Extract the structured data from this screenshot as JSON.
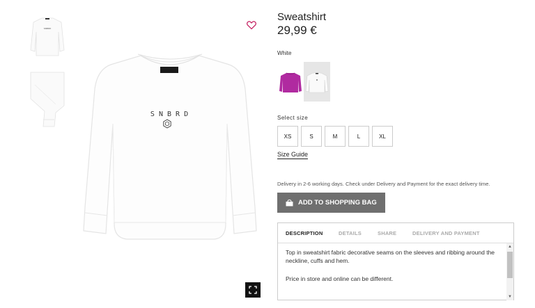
{
  "product": {
    "title": "Sweatshirt",
    "price": "29,99 €",
    "print_text": "S N B R D",
    "colors": {
      "selected_label": "White",
      "options": [
        {
          "name": "purple",
          "hex": "#b02aa0"
        },
        {
          "name": "white",
          "hex": "#f5f5f5"
        }
      ]
    }
  },
  "sizes": {
    "label": "Select size",
    "options": [
      "XS",
      "S",
      "M",
      "L",
      "XL"
    ],
    "guide_label": "Size Guide"
  },
  "delivery_text": "Delivery in 2-6 working days. Check under Delivery and Payment for the exact delivery time.",
  "add_to_bag": {
    "label": "ADD TO SHOPPING BAG",
    "icon": "shopping-bag-icon",
    "color": "#6f6f6f"
  },
  "tabs": [
    {
      "label": "DESCRIPTION",
      "active": true
    },
    {
      "label": "DETAILS",
      "active": false
    },
    {
      "label": "SHARE",
      "active": false
    },
    {
      "label": "DELIVERY AND PAYMENT",
      "active": false
    }
  ],
  "description": {
    "paragraph1": "Top in sweatshirt fabric decorative seams on the sleeves and ribbing around the neckline, cuffs and hem.",
    "paragraph2": "Price in store and online can be different."
  },
  "icons": {
    "wishlist": "heart-icon",
    "fullscreen": "expand-icon"
  },
  "accent": "#c2185b"
}
